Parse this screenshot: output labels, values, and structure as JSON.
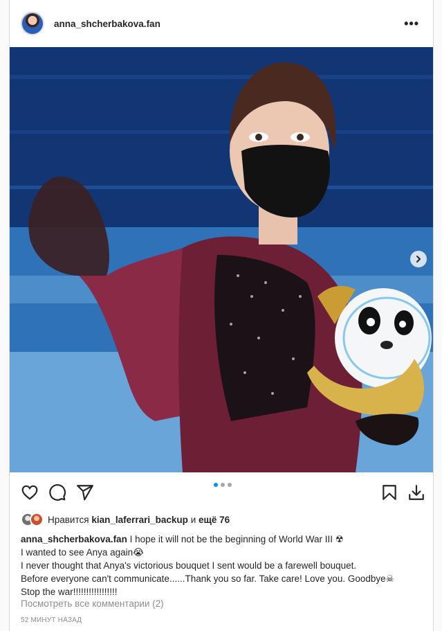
{
  "header": {
    "username": "anna_shcherbakova.fan",
    "more_label": "•••"
  },
  "media": {
    "carousel_count": 3,
    "active_index": 0
  },
  "actions": {
    "icons": [
      "heart-icon",
      "comment-icon",
      "share-icon",
      "bookmark-icon",
      "download-icon"
    ]
  },
  "likes": {
    "prefix": "Нравится",
    "user": "kian_laferrari_backup",
    "joiner": "и",
    "more": "ещё 76"
  },
  "caption": {
    "author": "anna_shcherbakova.fan",
    "lines": [
      "I hope it will not be the beginning of World War III ☢",
      "I wanted to see Anya again😭",
      "I never thought that Anya's victorious bouquet I sent would be a farewell bouquet.",
      "Before everyone can't communicate......Thank you so far. Take care! Love you. Goodbye☠",
      "Stop the war!!!!!!!!!!!!!!!!!"
    ]
  },
  "comments_link": "Посмотреть все комментарии (2)",
  "timestamp": "52 МИНУТ НАЗАД",
  "colors": {
    "accent_blue": "#0095f6",
    "text": "#262626",
    "muted": "#8e8e8e"
  }
}
